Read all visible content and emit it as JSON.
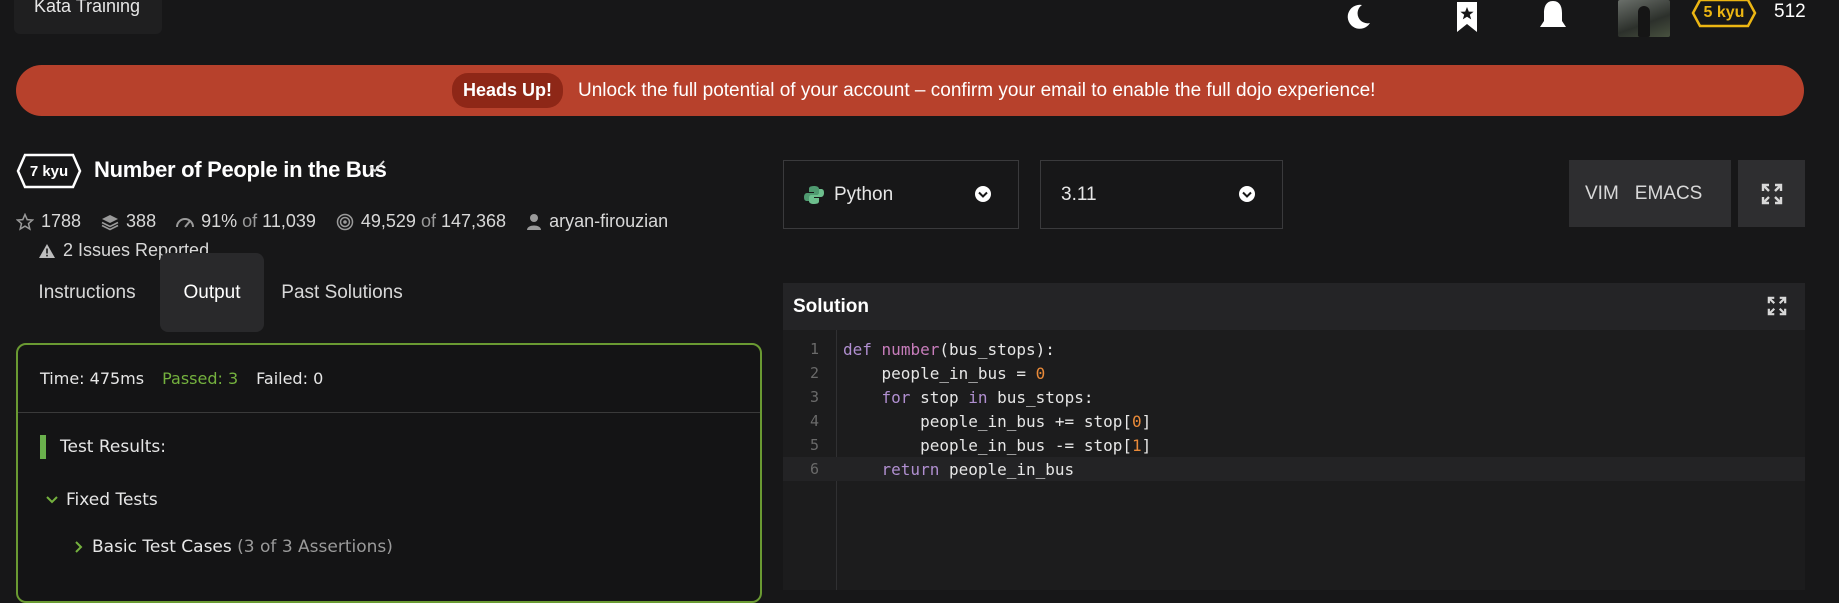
{
  "topbar": {
    "training_label": "Kata Training",
    "rank": "5 kyu",
    "honor": "512",
    "icons": [
      "moon-icon",
      "bookmark-star-icon",
      "bell-icon",
      "avatar"
    ]
  },
  "banner": {
    "pill": "Heads Up!",
    "message": "Unlock the full potential of your account – confirm your email to enable the full dojo experience!"
  },
  "kata": {
    "rank": "7 kyu",
    "title": "Number of People in the Bus",
    "stats": {
      "stars": "1788",
      "collections": "388",
      "satisfaction_pct": "91%",
      "satisfaction_of": "of",
      "satisfaction_votes": "11,039",
      "completed": "49,529",
      "completed_of": "of",
      "attempted": "147,368",
      "author": "aryan-firouzian"
    },
    "issues": "2 Issues Reported"
  },
  "tabs": {
    "instructions": "Instructions",
    "output": "Output",
    "past": "Past Solutions"
  },
  "output": {
    "time": "Time: 475ms",
    "passed": "Passed: 3",
    "failed": "Failed: 0",
    "results_label": "Test Results:",
    "group": "Fixed Tests",
    "subgroup": "Basic Test Cases",
    "subgroup_count": "(3 of 3 Assertions)"
  },
  "language": {
    "name": "Python",
    "version": "3.11"
  },
  "editor_modes": {
    "vim": "VIM",
    "emacs": "EMACS"
  },
  "solution": {
    "label": "Solution",
    "lines": [
      {
        "n": "1",
        "code": "def number(bus_stops):"
      },
      {
        "n": "2",
        "code": "    people_in_bus = 0"
      },
      {
        "n": "3",
        "code": "    for stop in bus_stops:"
      },
      {
        "n": "4",
        "code": "        people_in_bus += stop[0]"
      },
      {
        "n": "5",
        "code": "        people_in_bus -= stop[1]"
      },
      {
        "n": "6",
        "code": "    return people_in_bus"
      }
    ]
  },
  "colors": {
    "banner": "#b7412c",
    "passed": "#74b13e",
    "rank_yellow": "#ecb613",
    "panel_border": "#6a9a32"
  }
}
